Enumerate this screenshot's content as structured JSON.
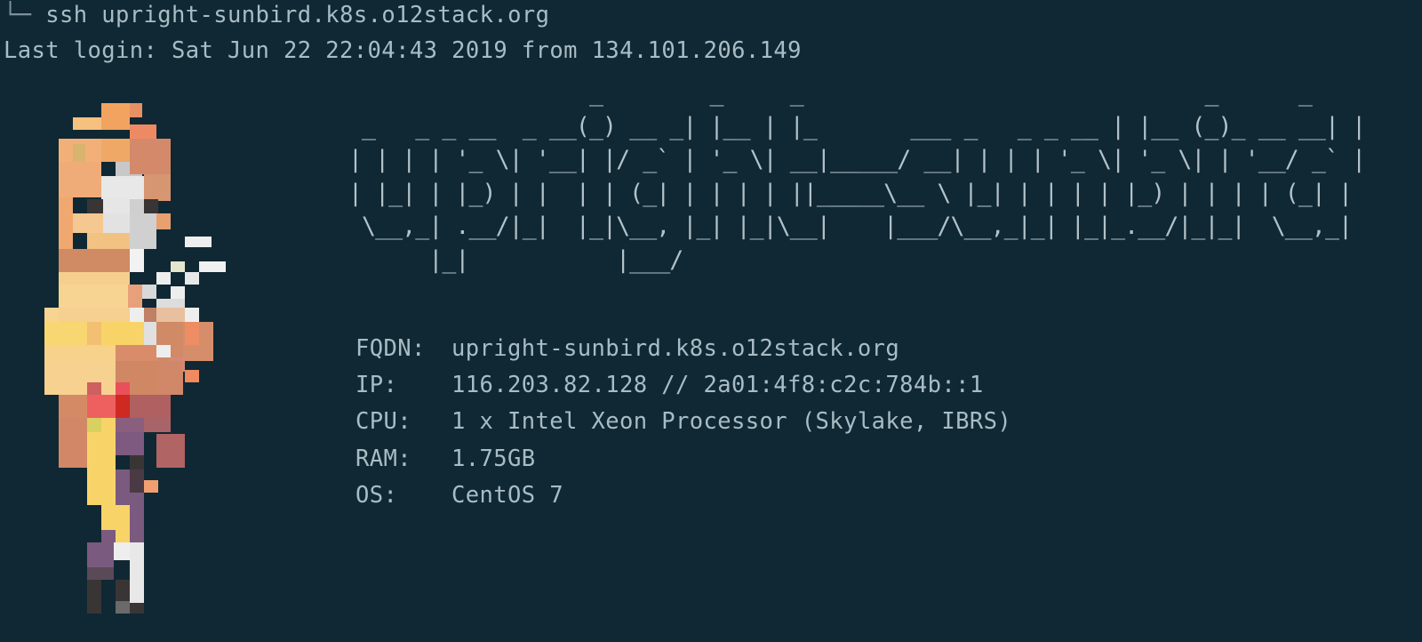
{
  "terminal": {
    "command_prefix": "└─ ",
    "command": "ssh upright-sunbird.k8s.o12stack.org",
    "last_login": "Last login: Sat Jun 22 22:04:43 2019 from 134.101.206.149",
    "banner": "                  _        _     _                              _      _           _\n _   _ _ __  _ __(_) __ _| |__ | |_       ___ _   _ _ __ | |__ (_)_ __ __| |\n| | | | '_ \\| '__| |/ _` | '_ \\| __|_____/ __| | | | '_ \\| '_ \\| | '__/ _` |\n| |_| | |_) | |  | | (_| | | | | ||_____\\__ \\ |_| | | | | |_) | | | | (_| |\n \\__,_| .__/|_|  |_|\\__, |_| |_|\\__|    |___/\\__,_|_| |_|_.__/|_|_|  \\__,_|\n      |_|           |___/",
    "info": [
      {
        "label": "FQDN:",
        "value": "upright-sunbird.k8s.o12stack.org"
      },
      {
        "label": "IP:",
        "value": "116.203.82.128 // 2a01:4f8:c2c:784b::1"
      },
      {
        "label": "CPU:",
        "value": "1 x Intel Xeon Processor (Skylake, IBRS)"
      },
      {
        "label": "RAM:",
        "value": "1.75GB"
      },
      {
        "label": "OS:",
        "value": "CentOS 7"
      }
    ]
  },
  "colors": {
    "background": "#0f2834",
    "text": "#a9bcc4"
  },
  "icons": [
    "pixel-art-character-icon"
  ]
}
